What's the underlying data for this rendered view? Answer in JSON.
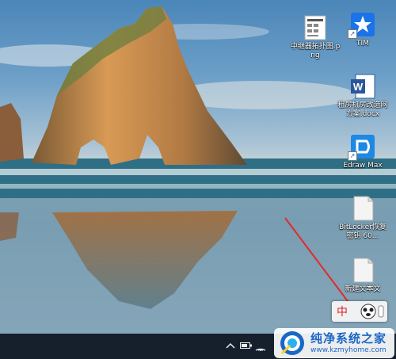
{
  "desktop": {
    "icons": [
      {
        "id": "relay-png",
        "label": "中继器拓扑图.png",
        "icon": "image-file-icon"
      },
      {
        "id": "tim",
        "label": "TIM",
        "icon": "tim-app-icon"
      },
      {
        "id": "word-doc",
        "label": "租房机房改造网方案.docx",
        "icon": "word-document-icon"
      },
      {
        "id": "edraw",
        "label": "Edraw Max",
        "icon": "edraw-max-icon"
      },
      {
        "id": "bitlocker",
        "label": "BitLocker恢复密钥 60...",
        "icon": "text-file-icon"
      },
      {
        "id": "new-text",
        "label": "新建文本文",
        "icon": "text-file-icon"
      }
    ]
  },
  "ime": {
    "mode": "中"
  },
  "taskbar": {
    "tray_icons": [
      "chevron-up-icon",
      "battery-icon",
      "wifi-icon"
    ]
  },
  "watermark": {
    "title": "纯净系统之家",
    "url": "www.kzmyhome.com"
  },
  "colors": {
    "taskbar": "#161f2c",
    "accent": "#1b67c7",
    "annotation_arrow": "#e02a2a"
  }
}
